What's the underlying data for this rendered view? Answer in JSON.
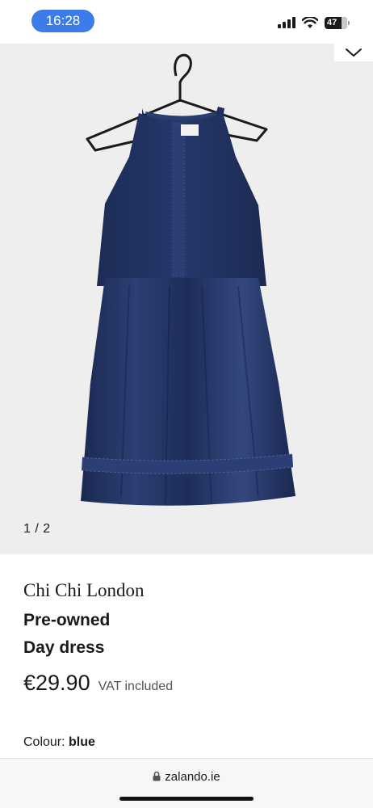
{
  "status_bar": {
    "time": "16:28",
    "battery_level": "47",
    "icons": [
      "signal-icon",
      "wifi-icon",
      "battery-icon"
    ]
  },
  "gallery": {
    "counter": "1 / 2",
    "image": "navy-halter-dress-on-hanger",
    "dress_color": "#1f2f5c"
  },
  "product": {
    "brand": "Chi Chi London",
    "name_line1": "Pre-owned",
    "name_line2": "Day dress",
    "price": "€29.90",
    "vat_note": "VAT included",
    "colour_label": "Colour:",
    "colour_value": "blue"
  },
  "browser": {
    "url": "zalando.ie"
  }
}
